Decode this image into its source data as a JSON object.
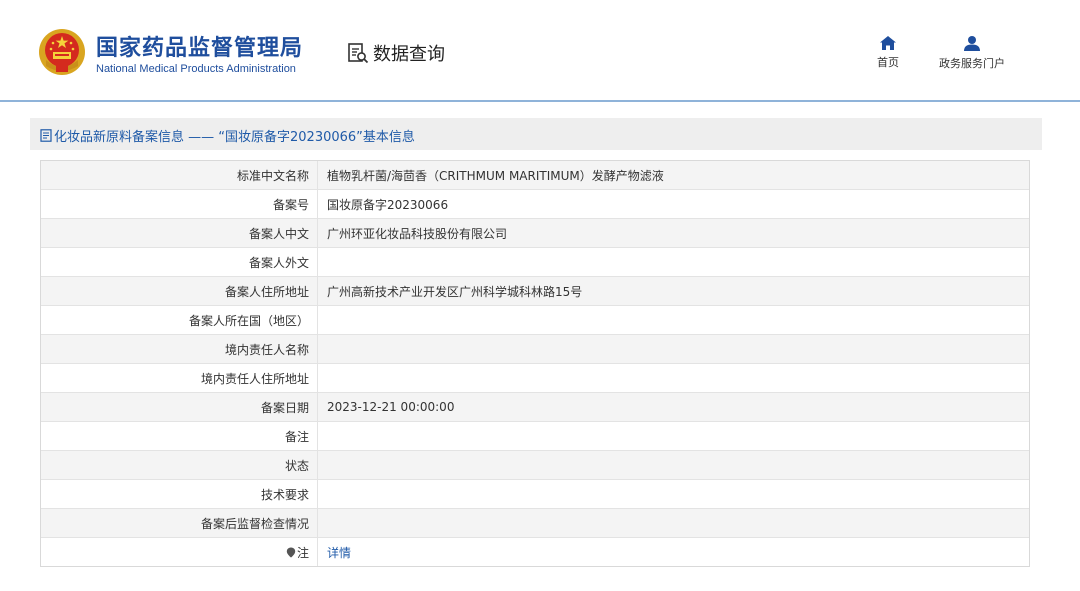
{
  "header": {
    "org_name_cn": "国家药品监督管理局",
    "org_name_en": "National Medical Products Administration",
    "module_title": "数据查询",
    "emblem_icon": "national-emblem-icon",
    "module_icon": "document-search-icon",
    "nav": [
      {
        "label": "首页",
        "icon": "home-icon"
      },
      {
        "label": "政务服务门户",
        "icon": "user-icon"
      }
    ]
  },
  "panel": {
    "title": "化妆品新原料备案信息 —— “国妆原备字20230066”基本信息",
    "title_icon": "document-icon"
  },
  "rows": [
    {
      "label": "标准中文名称",
      "value": "植物乳杆菌/海茴香（CRITHMUM MARITIMUM）发酵产物滤液"
    },
    {
      "label": "备案号",
      "value": "国妆原备字20230066"
    },
    {
      "label": "备案人中文",
      "value": "广州环亚化妆品科技股份有限公司"
    },
    {
      "label": "备案人外文",
      "value": ""
    },
    {
      "label": "备案人住所地址",
      "value": "广州高新技术产业开发区广州科学城科林路15号"
    },
    {
      "label": "备案人所在国（地区）",
      "value": ""
    },
    {
      "label": "境内责任人名称",
      "value": ""
    },
    {
      "label": "境内责任人住所地址",
      "value": ""
    },
    {
      "label": "备案日期",
      "value": "2023-12-21 00:00:00"
    },
    {
      "label": "备注",
      "value": ""
    },
    {
      "label": "状态",
      "value": ""
    },
    {
      "label": "技术要求",
      "value": ""
    },
    {
      "label": "备案后监督检查情况",
      "value": ""
    }
  ],
  "note_row": {
    "label": "注",
    "label_icon": "pin-icon",
    "link": "详情"
  },
  "colors": {
    "brand_blue": "#1f4e9d",
    "link_blue": "#1f5aa8",
    "header_line": "#8fb3d9",
    "panel_bg": "#eeeeee"
  }
}
